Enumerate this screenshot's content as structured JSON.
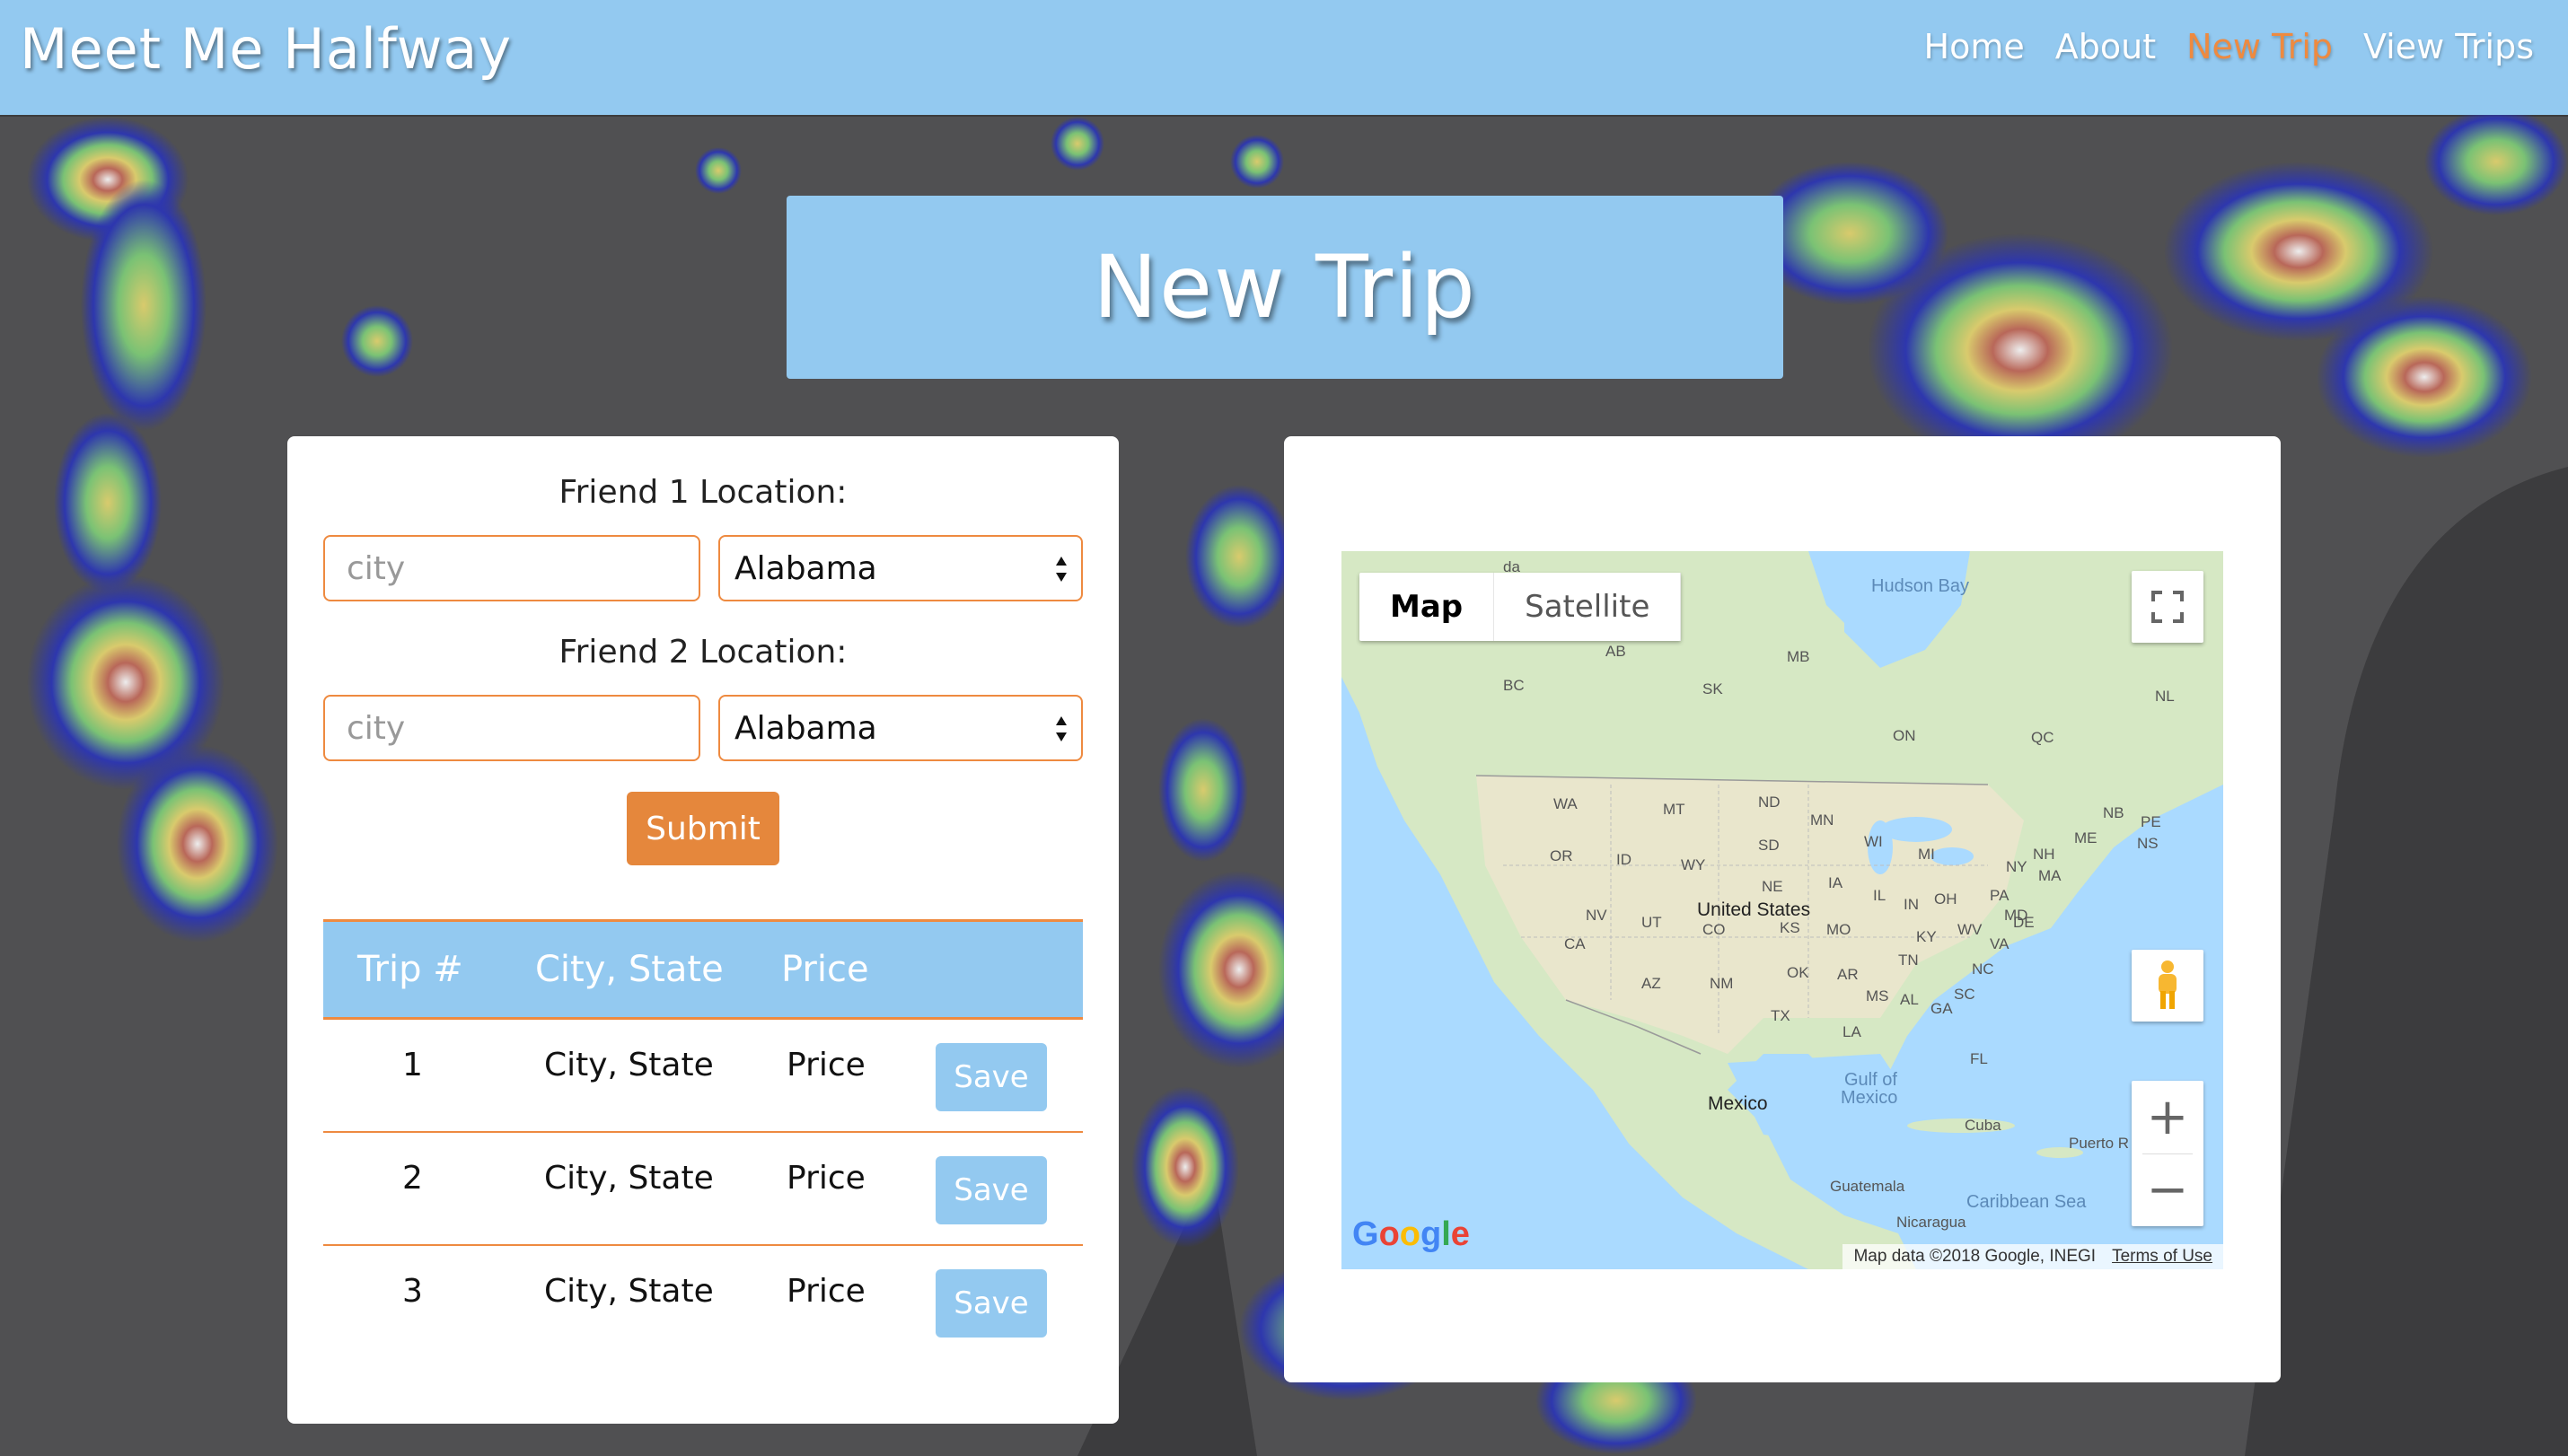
{
  "app": {
    "brand": "Meet Me Halfway",
    "nav": [
      {
        "label": "Home",
        "active": false
      },
      {
        "label": "About",
        "active": false
      },
      {
        "label": "New Trip",
        "active": true
      },
      {
        "label": "View Trips",
        "active": false
      }
    ]
  },
  "page": {
    "title": "New Trip"
  },
  "form": {
    "friend1": {
      "label": "Friend 1 Location:",
      "city_placeholder": "city",
      "state": "Alabama"
    },
    "friend2": {
      "label": "Friend 2 Location:",
      "city_placeholder": "city",
      "state": "Alabama"
    },
    "submit_label": "Submit"
  },
  "table": {
    "headers": [
      "Trip #",
      "City, State",
      "Price"
    ],
    "rows": [
      {
        "num": "1",
        "city": "City, State",
        "price": "Price",
        "save": "Save"
      },
      {
        "num": "2",
        "city": "City, State",
        "price": "Price",
        "save": "Save"
      },
      {
        "num": "3",
        "city": "City, State",
        "price": "Price",
        "save": "Save"
      }
    ]
  },
  "map": {
    "type_buttons": [
      {
        "label": "Map",
        "active": true
      },
      {
        "label": "Satellite",
        "active": false
      }
    ],
    "zoom_in": "+",
    "zoom_out": "−",
    "logo": "Google",
    "attribution": "Map data ©2018 Google, INEGI",
    "terms": "Terms of Use",
    "labels": {
      "hudson_bay": "Hudson Bay",
      "canada_fragment": "da",
      "ab": "AB",
      "mb": "MB",
      "bc": "BC",
      "sk": "SK",
      "on": "ON",
      "qc": "QC",
      "nl": "NL",
      "wa": "WA",
      "mt": "MT",
      "nd": "ND",
      "mn": "MN",
      "wi": "WI",
      "mi": "MI",
      "or": "OR",
      "id": "ID",
      "wy": "WY",
      "sd": "SD",
      "ne": "NE",
      "ia": "IA",
      "nv": "NV",
      "ut": "UT",
      "co": "CO",
      "ks": "KS",
      "mo": "MO",
      "il": "IL",
      "in": "IN",
      "oh": "OH",
      "pa": "PA",
      "ny": "NY",
      "ca": "CA",
      "az": "AZ",
      "nm": "NM",
      "ok": "OK",
      "ar": "AR",
      "tn": "TN",
      "ky": "KY",
      "wv": "WV",
      "va": "VA",
      "nc": "NC",
      "sc": "SC",
      "ga": "GA",
      "al": "AL",
      "ms": "MS",
      "la": "LA",
      "tx": "TX",
      "fl": "FL",
      "nb": "NB",
      "pe": "PE",
      "ns": "NS",
      "me": "ME",
      "nh": "NH",
      "ma": "MA",
      "md": "MD",
      "de": "DE",
      "united_states": "United States",
      "mexico": "Mexico",
      "gulf": "Gulf of",
      "gulf2": "Mexico",
      "cuba": "Cuba",
      "puerto_rico": "Puerto R",
      "guatemala": "Guatemala",
      "caribbean": "Caribbean Sea",
      "nicaragua": "Nicaragua"
    }
  },
  "colors": {
    "nav_bg": "#93c9f0",
    "accent": "#ee8a40",
    "submit": "#e5873c",
    "save": "#93c9f0"
  }
}
